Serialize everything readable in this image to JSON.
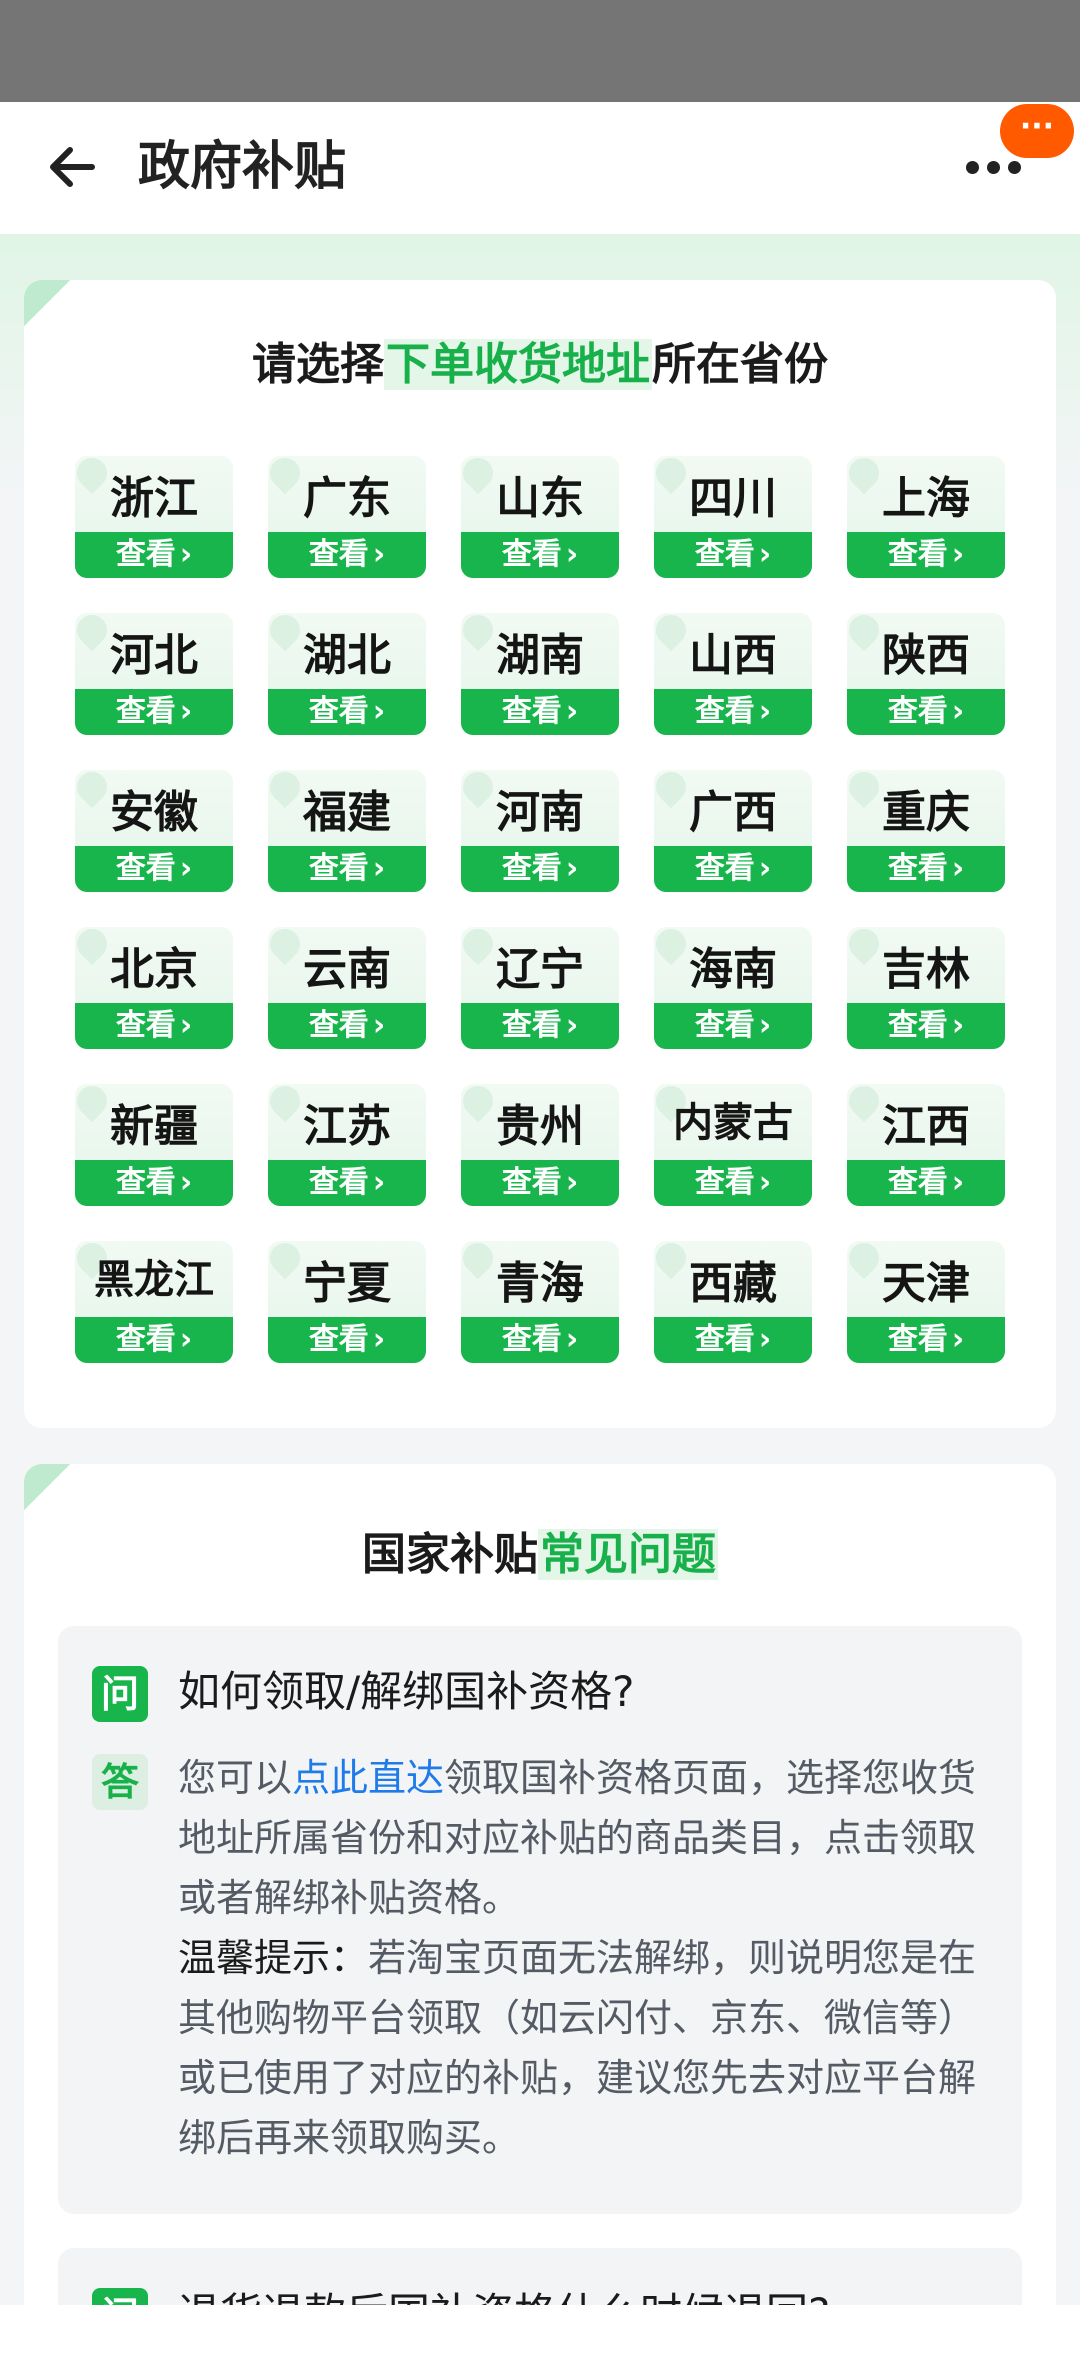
{
  "header": {
    "title": "政府补贴",
    "back_icon": "arrow-left-icon",
    "more_icon": "more-dots-icon",
    "pill_label": "···"
  },
  "province_section": {
    "heading_prefix": "请选择",
    "heading_highlight": "下单收货地址",
    "heading_suffix": "所在省份",
    "view_label": "查看",
    "provinces": [
      "浙江",
      "广东",
      "山东",
      "四川",
      "上海",
      "河北",
      "湖北",
      "湖南",
      "山西",
      "陕西",
      "安徽",
      "福建",
      "河南",
      "广西",
      "重庆",
      "北京",
      "云南",
      "辽宁",
      "海南",
      "吉林",
      "新疆",
      "江苏",
      "贵州",
      "内蒙古",
      "江西",
      "黑龙江",
      "宁夏",
      "青海",
      "西藏",
      "天津"
    ]
  },
  "faq_section": {
    "heading_prefix": "国家补贴",
    "heading_highlight": "常见问题",
    "q_badge": "问",
    "a_badge": "答",
    "faq1": {
      "question": "如何领取/解绑国补资格?",
      "answer_pre": "您可以",
      "answer_link": "点此直达",
      "answer_post": "领取国补资格页面，选择您收货地址所属省份和对应补贴的商品类目，点击领取或者解绑补贴资格。",
      "tip_label": "温馨提示：",
      "tip_text": "若淘宝页面无法解绑，则说明您是在其他购物平台领取（如云闪付、京东、微信等）或已使用了对应的补贴，建议您先去对应平台解绑后再来领取购买。"
    },
    "faq2": {
      "question": "退货退款后国补资格什么时候退回?"
    }
  }
}
